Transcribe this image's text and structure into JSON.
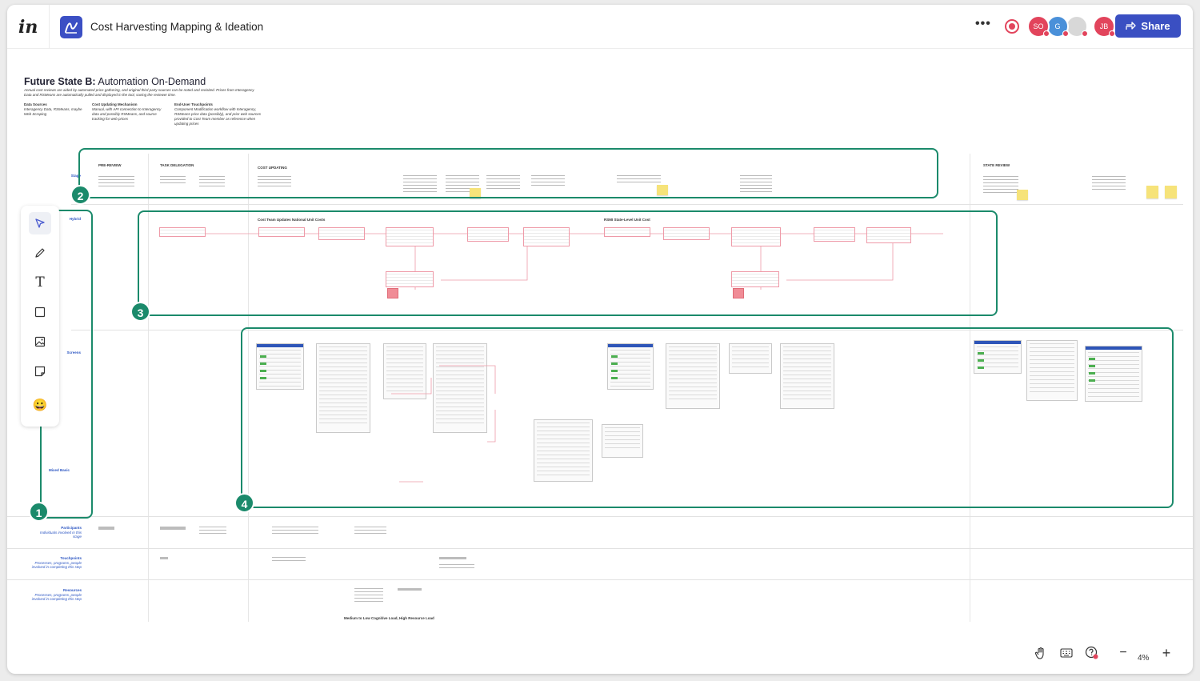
{
  "app": {
    "logo": "in",
    "title": "Cost Harvesting Mapping & Ideation"
  },
  "header": {
    "more_label": "•••",
    "share_label": "Share",
    "avatars": [
      {
        "initials": "SO",
        "color": "#e2445c",
        "dot": "#e2445c"
      },
      {
        "initials": "G",
        "color": "#4a90d9",
        "dot": "#e2445c"
      },
      {
        "initials": "",
        "color": "#d8d8d8",
        "dot": "#e2445c"
      },
      {
        "initials": "JB",
        "color": "#e2445c",
        "dot": "#e2445c"
      }
    ]
  },
  "board": {
    "title_bold": "Future State B:",
    "title_rest": " Automation On-Demand",
    "subtitle": "Annual cost reviews are aided by automated price gathering, and original third party sources can be noted and revisited. Prices from Interagency Data and RSMeans are automatically pulled and displayed in the tool, saving the reviewer time.",
    "info": [
      {
        "heading": "Data Sources",
        "text": "Interagency Data, RSMeans, maybe Web Scraping"
      },
      {
        "heading": "Cost Updating Mechanism",
        "text": "Manual, with API connection to Interagency data and possibly RSMeans, and source tracking for web prices"
      },
      {
        "heading": "End-User Touchpoints",
        "text": "Component Modification workflow with Interagency, RSMeans price data (possibly), and prior web sources provided to Cost Team member as reference when updating prices"
      }
    ],
    "phases": [
      "PRE-REVIEW",
      "TASK DELEGATION",
      "COST UPDATING",
      "STATE REVIEW"
    ],
    "lanes": [
      {
        "title": "Participants",
        "sub": "Individuals involved in this stage"
      },
      {
        "title": "Touchpoints",
        "sub": "Processes, programs, people involved in completing this step"
      },
      {
        "title": "Resources",
        "sub": "Processes, programs, people involved in completing this step"
      }
    ],
    "swimlane_small": [
      "Stage",
      "Hybrid",
      "Screens",
      "Mixed Basic"
    ],
    "process_headers": [
      "Cost Team Updates National Unit Costs",
      "RSMI State-Level Unit Cost"
    ],
    "footer_note": "Medium to Low Cognitive Load, High Resource Load"
  },
  "callouts": [
    "1",
    "2",
    "3",
    "4"
  ],
  "toolbar": {
    "tools": [
      "select-tool",
      "pen-tool",
      "text-tool",
      "shape-tool",
      "image-tool",
      "sticky-note-tool",
      "emoji-tool"
    ],
    "text_glyph": "T",
    "emoji_glyph": "😀"
  },
  "bottom_controls": {
    "zoom_out": "−",
    "zoom_in": "+",
    "zoom_level": "4%"
  },
  "colors": {
    "accent": "#3a4fc2",
    "callout": "#1b8a6b",
    "process_line": "#ee9aa8",
    "sticky": "#f6e37a"
  }
}
